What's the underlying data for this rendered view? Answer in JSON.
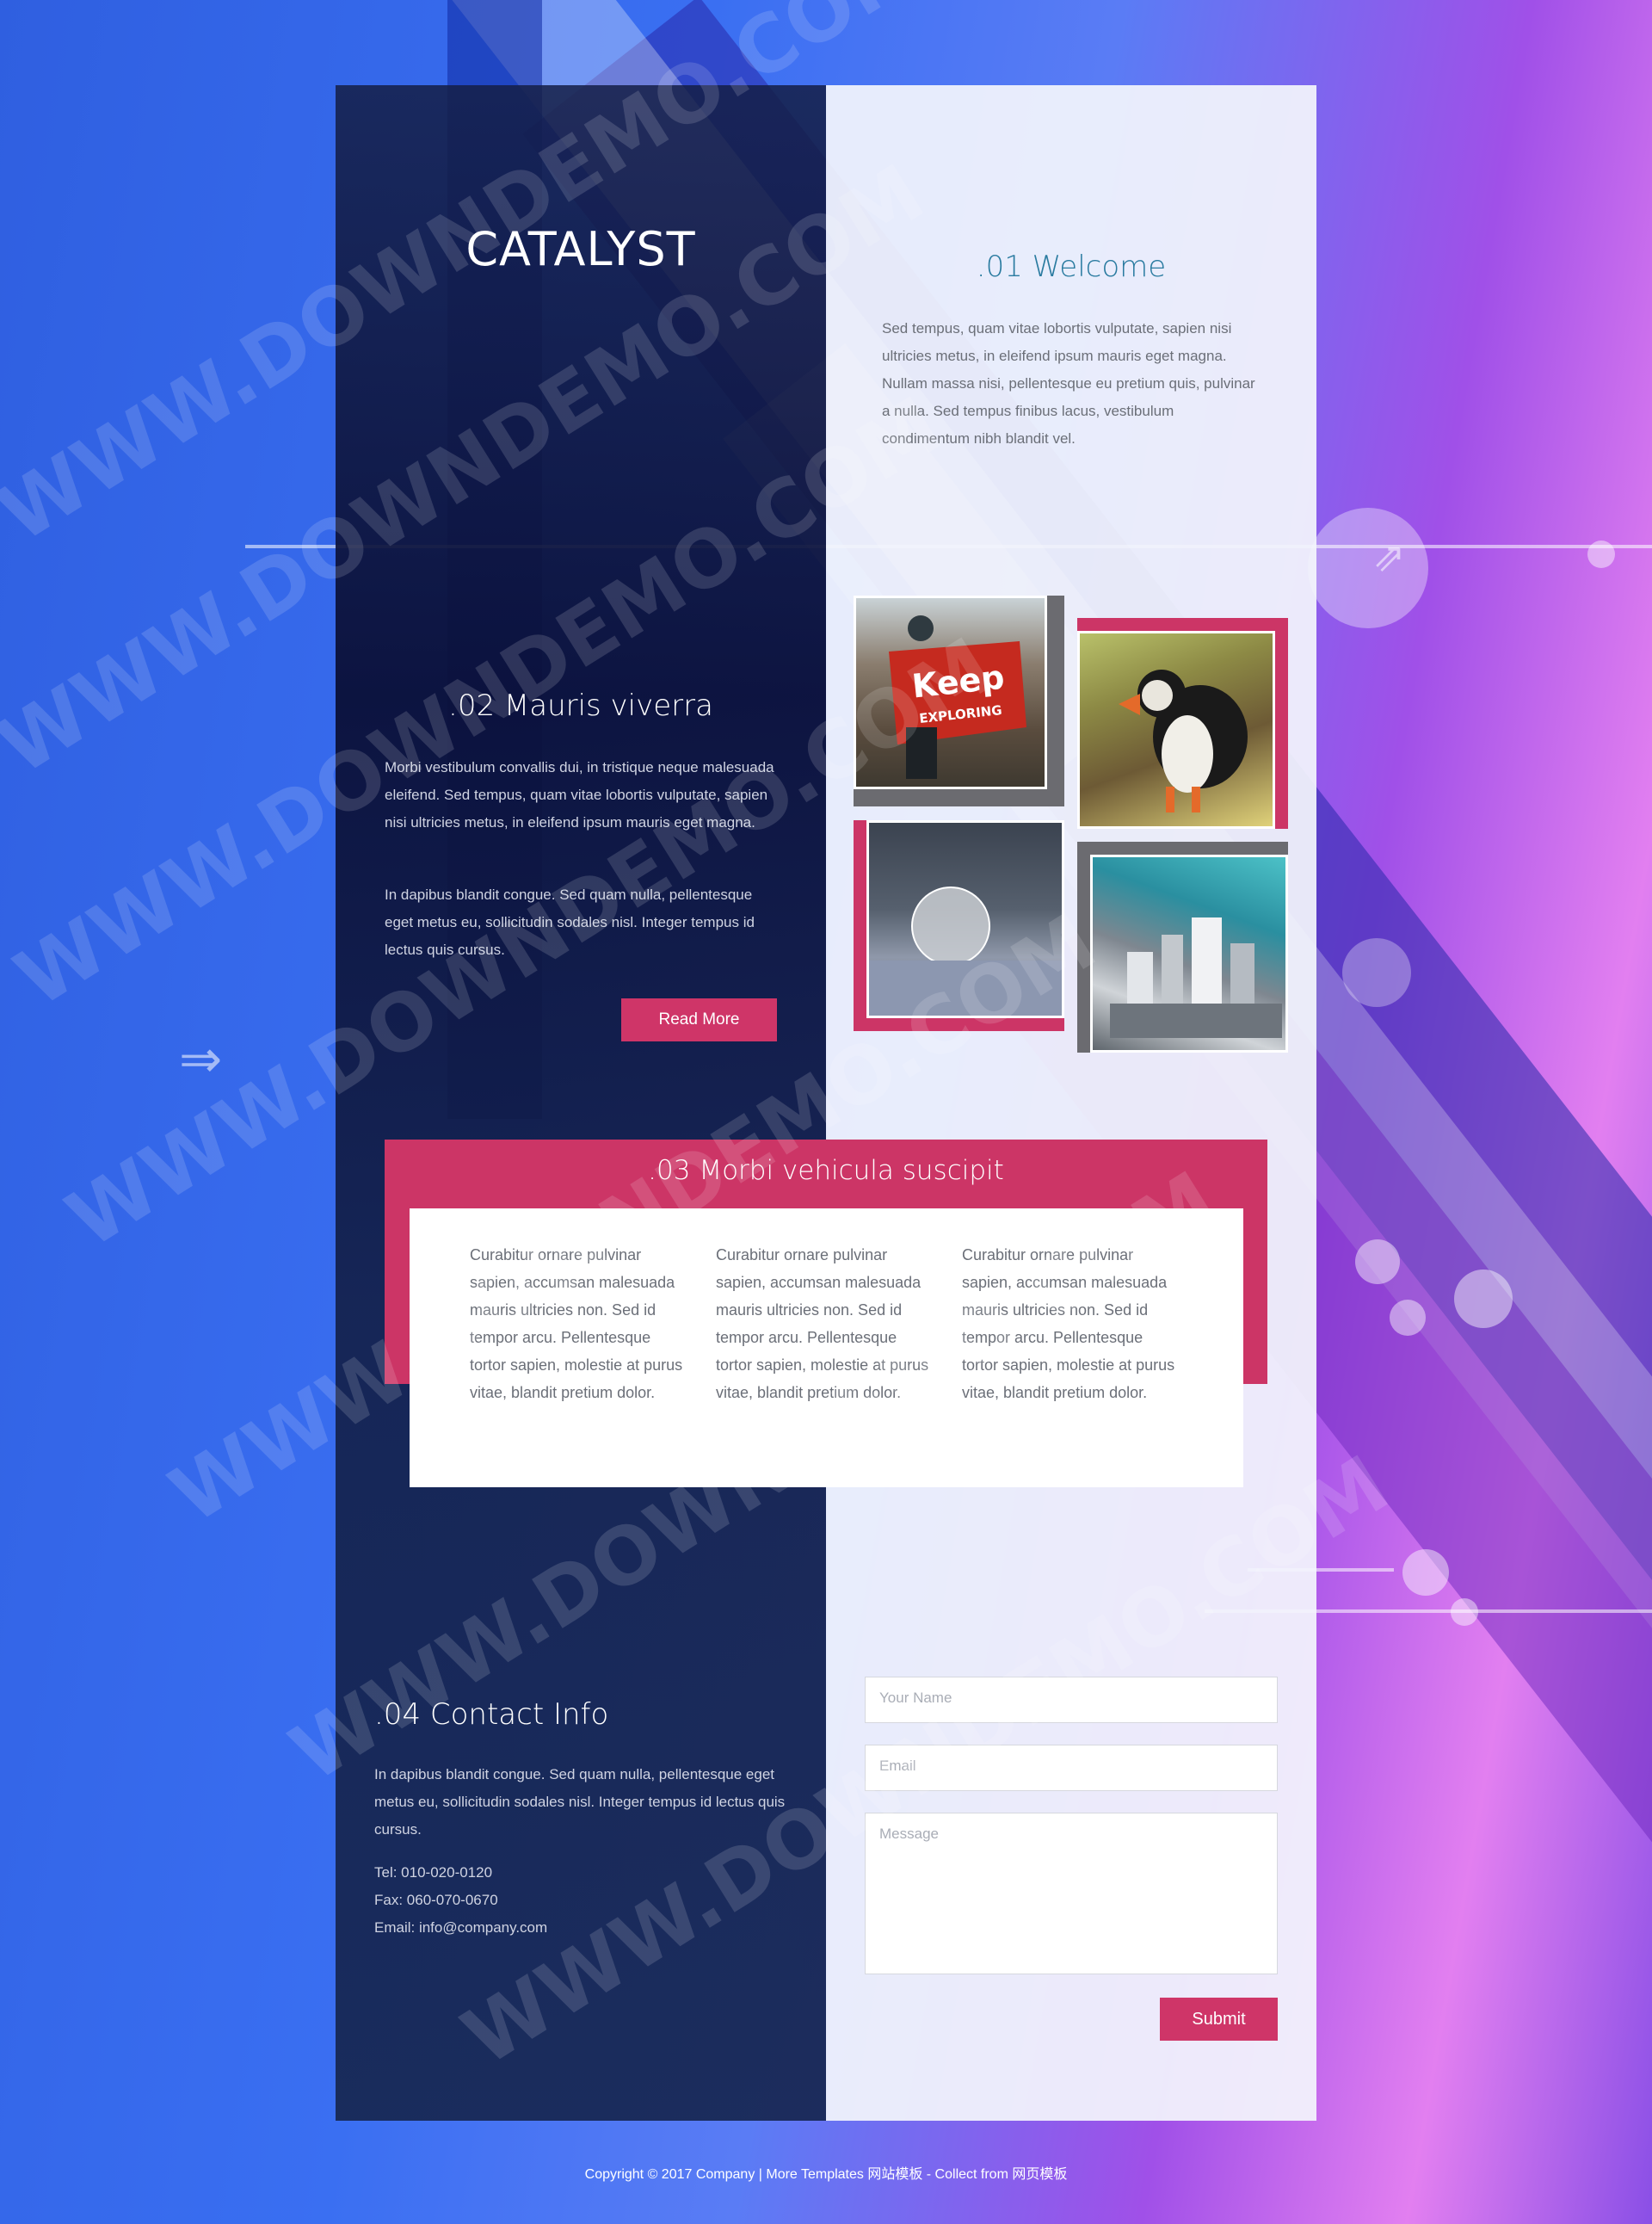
{
  "brand": "CATALYST",
  "welcome": {
    "title": ".01 Welcome",
    "text": "Sed tempus, quam vitae lobortis vulputate, sapien nisi ultricies metus, in eleifend ipsum mauris eget magna. Nullam massa nisi, pellentesque eu pretium quis, pulvinar a nulla. Sed tempus finibus lacus, vestibulum condimentum nibh blandit vel."
  },
  "section2": {
    "title": ".02 Mauris viverra",
    "para1": "Morbi vestibulum convallis dui, in tristique neque malesuada eleifend. Sed tempus, quam vitae lobortis vulputate, sapien nisi ultricies metus, in eleifend ipsum mauris eget magna.",
    "para2": "In dapibus blandit congue. Sed quam nulla, pellentesque eget metus eu, sollicitudin sodales nisl. Integer tempus id lectus quis cursus.",
    "button": "Read More"
  },
  "section3": {
    "title": ".03 Morbi vehicula suscipit",
    "columns": [
      "Curabitur ornare pulvinar sapien, accumsan malesuada mauris ultricies non. Sed id tempor arcu. Pellentesque tortor sapien, molestie at purus vitae, blandit pretium dolor.",
      "Curabitur ornare pulvinar sapien, accumsan malesuada mauris ultricies non. Sed id tempor arcu. Pellentesque tortor sapien, molestie at purus vitae, blandit pretium dolor.",
      "Curabitur ornare pulvinar sapien, accumsan malesuada mauris ultricies non. Sed id tempor arcu. Pellentesque tortor sapien, molestie at purus vitae, blandit pretium dolor."
    ]
  },
  "contact": {
    "title": ".04 Contact Info",
    "text": "In dapibus blandit congue. Sed quam nulla, pellentesque eget metus eu, sollicitudin sodales nisl. Integer tempus id lectus quis cursus.",
    "tel": "Tel: 010-020-0120",
    "fax": "Fax: 060-070-0670",
    "email": "Email: info@company.com"
  },
  "form": {
    "name_placeholder": "Your Name",
    "email_placeholder": "Email",
    "message_placeholder": "Message",
    "submit": "Submit"
  },
  "gallery": {
    "image1_text": "Keep",
    "image1_subtext": "EXPLORING"
  },
  "footer": "Copyright © 2017 Company | More Templates 网站模板 - Collect from 网页模板",
  "watermark": "WWW.DOWNDEMO.COM",
  "colors": {
    "accent": "#cc3566",
    "welcome_title": "#2a7ba0",
    "frame_gray": "#6b6b70"
  }
}
